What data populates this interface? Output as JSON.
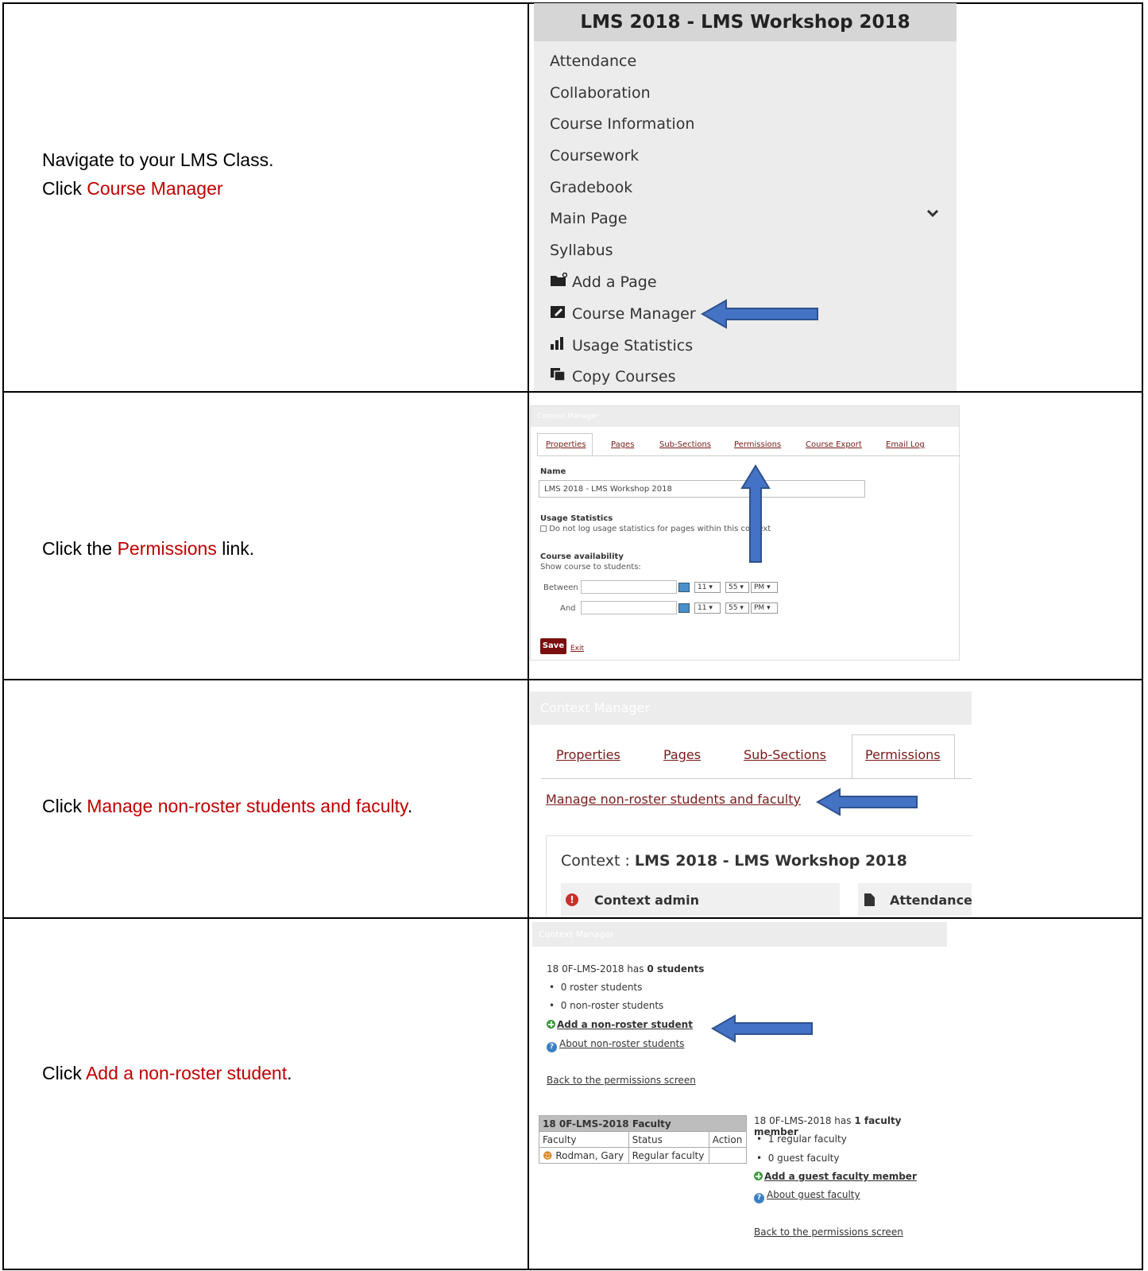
{
  "rows": [
    {
      "instruction_line1": "Navigate to your LMS Class.",
      "instruction_prefix": "Click ",
      "instruction_highlight": "Course Manager",
      "instruction_suffix": ""
    },
    {
      "instruction_prefix": "Click the ",
      "instruction_highlight": "Permissions",
      "instruction_suffix": " link."
    },
    {
      "instruction_prefix": "Click ",
      "instruction_highlight": "Manage non-roster students and faculty",
      "instruction_suffix": "."
    },
    {
      "instruction_prefix": "Click ",
      "instruction_highlight": "Add a non-roster student",
      "instruction_suffix": "."
    }
  ],
  "menu": {
    "title": "LMS 2018 - LMS Workshop 2018",
    "items": [
      "Attendance",
      "Collaboration",
      "Course Information",
      "Coursework",
      "Gradebook",
      "Main Page",
      "Syllabus"
    ],
    "tools": [
      {
        "label": "Add a Page",
        "icon": "folder-plus-icon"
      },
      {
        "label": "Course Manager",
        "icon": "edit-icon"
      },
      {
        "label": "Usage Statistics",
        "icon": "bar-chart-icon"
      },
      {
        "label": "Copy Courses",
        "icon": "copy-icon"
      }
    ]
  },
  "cm_small": {
    "header": "Context Manager",
    "tabs": [
      "Properties",
      "Pages",
      "Sub-Sections",
      "Permissions",
      "Course Export",
      "Email Log"
    ],
    "name_label": "Name",
    "name_value": "LMS 2018 - LMS Workshop 2018",
    "usage_label": "Usage Statistics",
    "usage_checkbox": "Do not log usage statistics for pages within this context",
    "avail_label": "Course availability",
    "avail_sub": "Show course to students:",
    "between": "Between",
    "and": "And",
    "hour": "11",
    "minute": "55",
    "ampm": "PM",
    "save": "Save",
    "exit": "Exit"
  },
  "cm_large": {
    "header": "Context Manager",
    "tabs": [
      "Properties",
      "Pages",
      "Sub-Sections",
      "Permissions"
    ],
    "manage_link": "Manage non-roster students and faculty",
    "context_prefix": "Context : ",
    "context_name": "LMS 2018 - LMS Workshop 2018",
    "context_admin": "Context admin",
    "attendance": "Attendance"
  },
  "cm_students": {
    "header": "Context Manager",
    "students_prefix": "18 0F-LMS-2018 has ",
    "students_count": "0 students",
    "roster": "0 roster students",
    "nonroster": "0 non-roster students",
    "add_student": "Add a non-roster student",
    "about_students": "About non-roster students",
    "back1": "Back to the permissions screen",
    "faculty_table_title": "18 0F-LMS-2018 Faculty",
    "col_faculty": "Faculty",
    "col_status": "Status",
    "col_action": "Action",
    "faculty_name": "Rodman, Gary",
    "faculty_status": "Regular faculty",
    "faculty_prefix": "18 0F-LMS-2018 has ",
    "faculty_count": "1 faculty member",
    "regular": "1 regular faculty",
    "guest": "0 guest faculty",
    "add_guest": "Add a guest faculty member",
    "about_guest": "About guest faculty",
    "back2": "Back to the permissions screen"
  },
  "colors": {
    "highlight": "#c00000",
    "arrow_fill": "#4472c4",
    "arrow_stroke": "#2f528f"
  }
}
